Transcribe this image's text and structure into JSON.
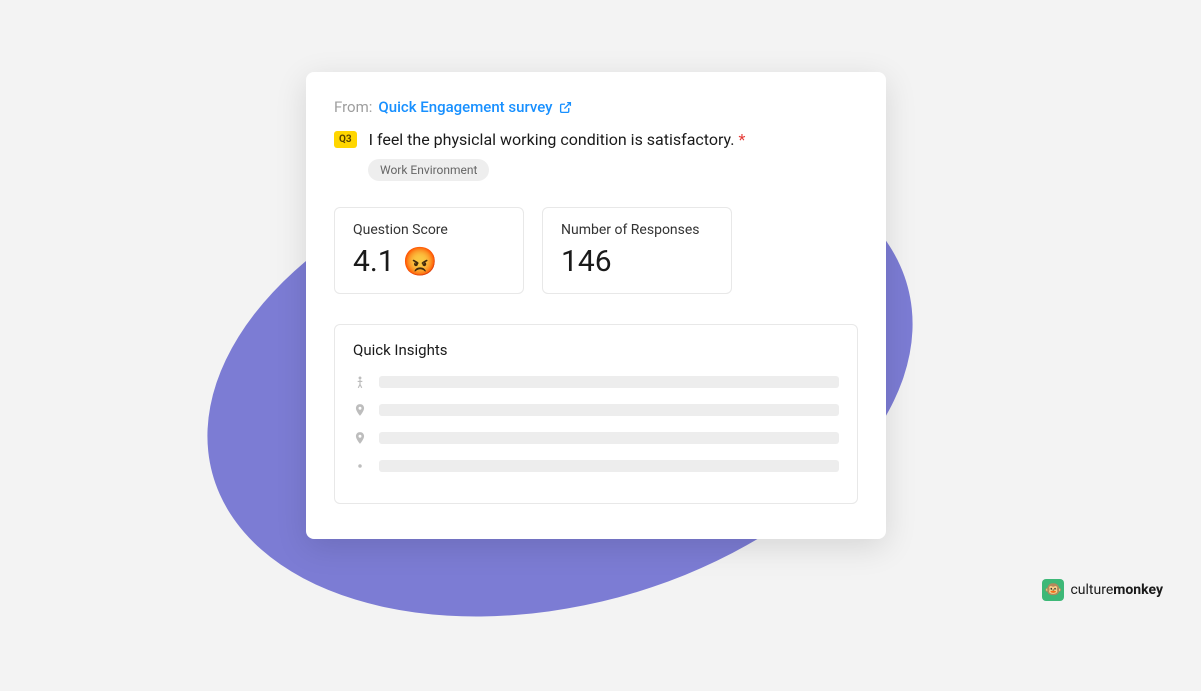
{
  "from": {
    "label": "From:",
    "link_text": "Quick Engagement survey"
  },
  "question": {
    "badge": "Q3",
    "text": "I feel the physiclal working condition is satisfactory.",
    "required_marker": "*",
    "tag": "Work Environment"
  },
  "stats": {
    "score": {
      "label": "Question Score",
      "value": "4.1",
      "emoji": "😡"
    },
    "responses": {
      "label": "Number of Responses",
      "value": "146"
    }
  },
  "insights": {
    "title": "Quick Insights"
  },
  "brand": {
    "name_light": "culture",
    "name_bold": "monkey"
  }
}
